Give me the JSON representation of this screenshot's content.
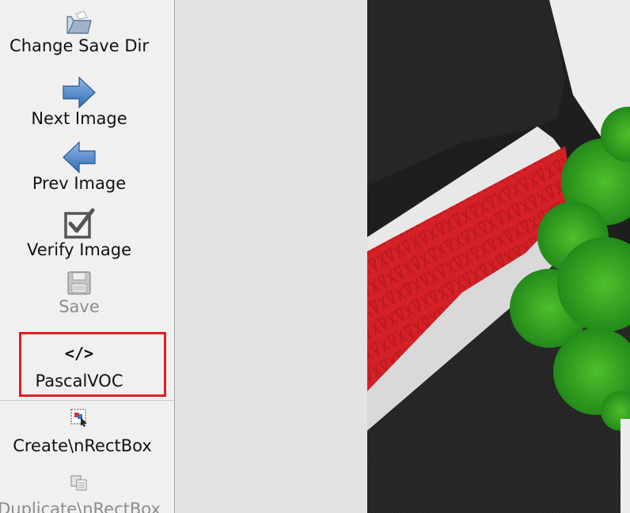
{
  "toolbar": {
    "items": [
      {
        "label": "Change Save Dir",
        "icon": "folder-open-icon",
        "enabled": true
      },
      {
        "label": "Next Image",
        "icon": "arrow-right-icon",
        "enabled": true
      },
      {
        "label": "Prev Image",
        "icon": "arrow-left-icon",
        "enabled": true
      },
      {
        "label": "Verify Image",
        "icon": "checkbox-check-icon",
        "enabled": true
      },
      {
        "label": "Save",
        "icon": "floppy-disk-icon",
        "enabled": false
      },
      {
        "label": "PascalVOC",
        "icon": "code-tag-icon",
        "enabled": true,
        "highlighted": true
      },
      {
        "label": "Create\\nRectBox",
        "icon": "create-rectbox-icon",
        "enabled": true
      },
      {
        "label": "Duplicate\\nRectBox",
        "icon": "duplicate-rectbox-icon",
        "enabled": false
      }
    ]
  },
  "colors": {
    "highlight_border": "#e31b23",
    "arrow_blue": "#4a86c8",
    "toolbar_bg": "#f0f0f0",
    "canvas_bg": "#e3e3e3"
  },
  "format_icon_text": "</>"
}
